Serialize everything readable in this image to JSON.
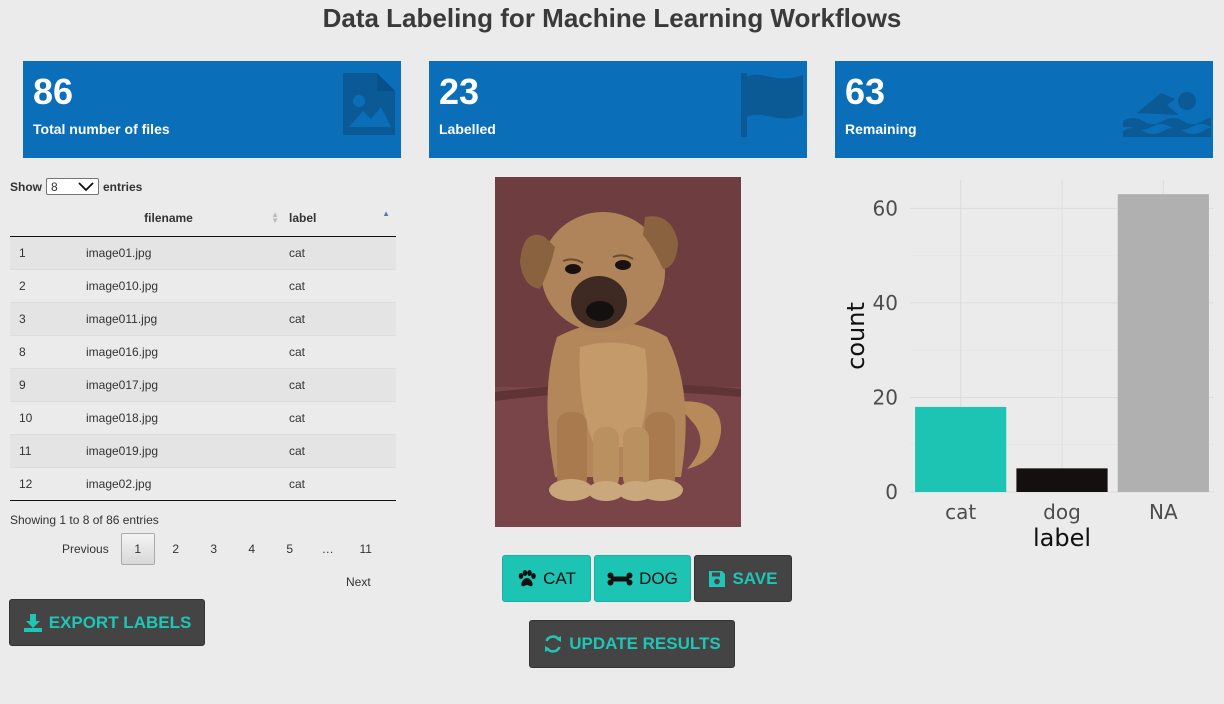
{
  "header": {
    "title": "Data Labeling for Machine Learning Workflows"
  },
  "value_boxes": [
    {
      "value": "86",
      "label": "Total number of files",
      "icon": "file-image-icon"
    },
    {
      "value": "23",
      "label": "Labelled",
      "icon": "flag-icon"
    },
    {
      "value": "63",
      "label": "Remaining",
      "icon": "swimmer-icon"
    }
  ],
  "colors": {
    "value_box": "#0a6eb8",
    "teal": "#1dc3b3",
    "dark_button": "#444444",
    "background": "#ebebeb"
  },
  "table": {
    "show_label": "Show",
    "entries_value": "8",
    "entries_label": "entries",
    "columns": [
      "",
      "filename",
      "label"
    ],
    "rows": [
      [
        "1",
        "image01.jpg",
        "cat"
      ],
      [
        "2",
        "image010.jpg",
        "cat"
      ],
      [
        "3",
        "image011.jpg",
        "cat"
      ],
      [
        "8",
        "image016.jpg",
        "cat"
      ],
      [
        "9",
        "image017.jpg",
        "cat"
      ],
      [
        "10",
        "image018.jpg",
        "cat"
      ],
      [
        "11",
        "image019.jpg",
        "cat"
      ],
      [
        "12",
        "image02.jpg",
        "cat"
      ]
    ],
    "info": "Showing 1 to 8 of 86 entries",
    "pagination": {
      "previous": "Previous",
      "pages": [
        "1",
        "2",
        "3",
        "4",
        "5",
        "…",
        "11"
      ],
      "current": "1",
      "next": "Next"
    }
  },
  "buttons": {
    "export": "EXPORT LABELS",
    "cat": "CAT",
    "dog": "DOG",
    "save": "SAVE",
    "update": "UPDATE RESULTS"
  },
  "chart_data": {
    "type": "bar",
    "categories": [
      "cat",
      "dog",
      "NA"
    ],
    "values": [
      18,
      5,
      63
    ],
    "colors": [
      "#1dc3b3",
      "#141010",
      "#b0b0b0"
    ],
    "xlabel": "label",
    "ylabel": "count",
    "yticks": [
      0,
      20,
      40,
      60
    ],
    "ylim": [
      0,
      66
    ],
    "grid": true
  }
}
